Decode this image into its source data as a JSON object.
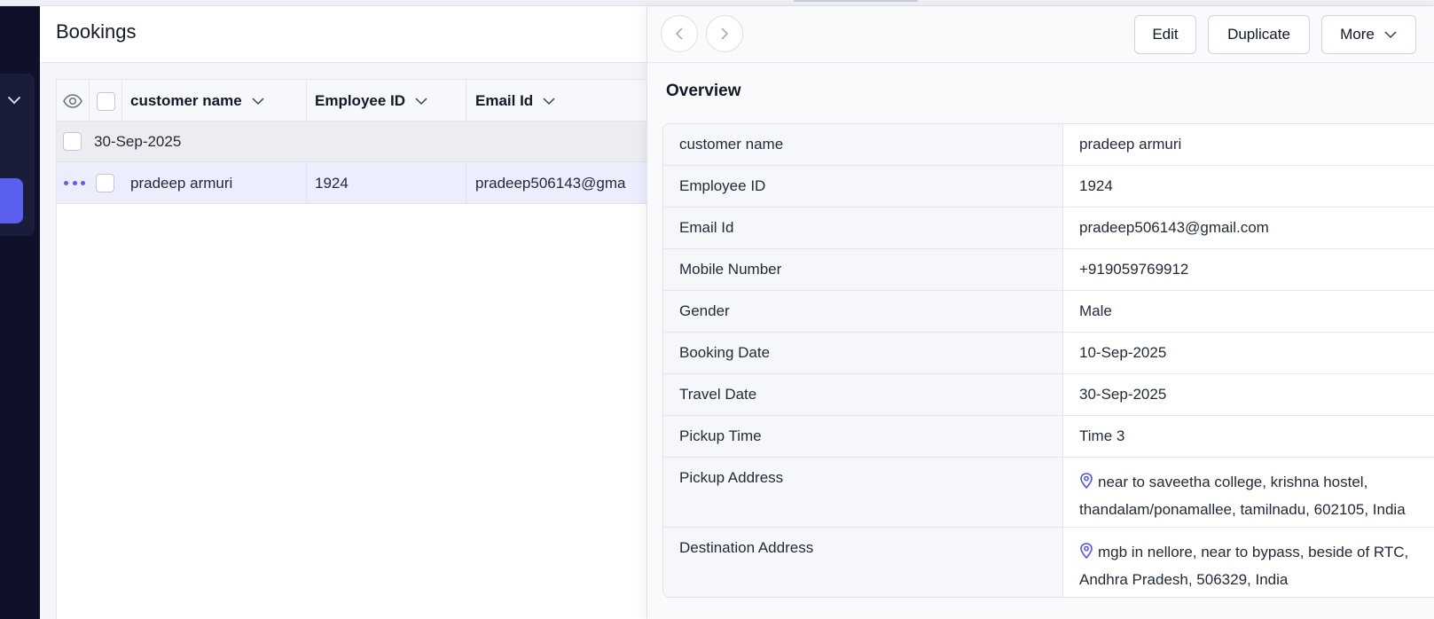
{
  "page": {
    "title": "Bookings"
  },
  "colors": {
    "accent": "#5b5ff0",
    "link": "#4f56e8",
    "sidebar_bg": "#0f1129"
  },
  "grid": {
    "columns": [
      {
        "label": "customer name"
      },
      {
        "label": "Employee ID"
      },
      {
        "label": "Email Id"
      }
    ],
    "group_label": "30-Sep-2025",
    "row": {
      "customer_name": "pradeep armuri",
      "employee_id": "1924",
      "email": "pradeep506143@gma"
    }
  },
  "detail": {
    "buttons": {
      "edit": "Edit",
      "duplicate": "Duplicate",
      "more": "More"
    },
    "overview_title": "Overview",
    "fields": [
      {
        "label": "customer name",
        "value": "pradeep armuri"
      },
      {
        "label": "Employee ID",
        "value": "1924"
      },
      {
        "label": "Email Id",
        "value": "pradeep506143@gmail.com"
      },
      {
        "label": "Mobile Number",
        "value": "+919059769912"
      },
      {
        "label": "Gender",
        "value": "Male"
      },
      {
        "label": "Booking Date",
        "value": "10-Sep-2025"
      },
      {
        "label": "Travel Date",
        "value": "30-Sep-2025"
      },
      {
        "label": "Pickup Time",
        "value": "Time 3"
      },
      {
        "label": "Pickup Address",
        "value": "near to saveetha college, krishna hostel, thandalam/ponamallee, tamilnadu, 602105, India"
      },
      {
        "label": "Destination Address",
        "value": "mgb in nellore, near to bypass, beside of RTC, Andhra Pradesh, 506329, India"
      }
    ]
  }
}
